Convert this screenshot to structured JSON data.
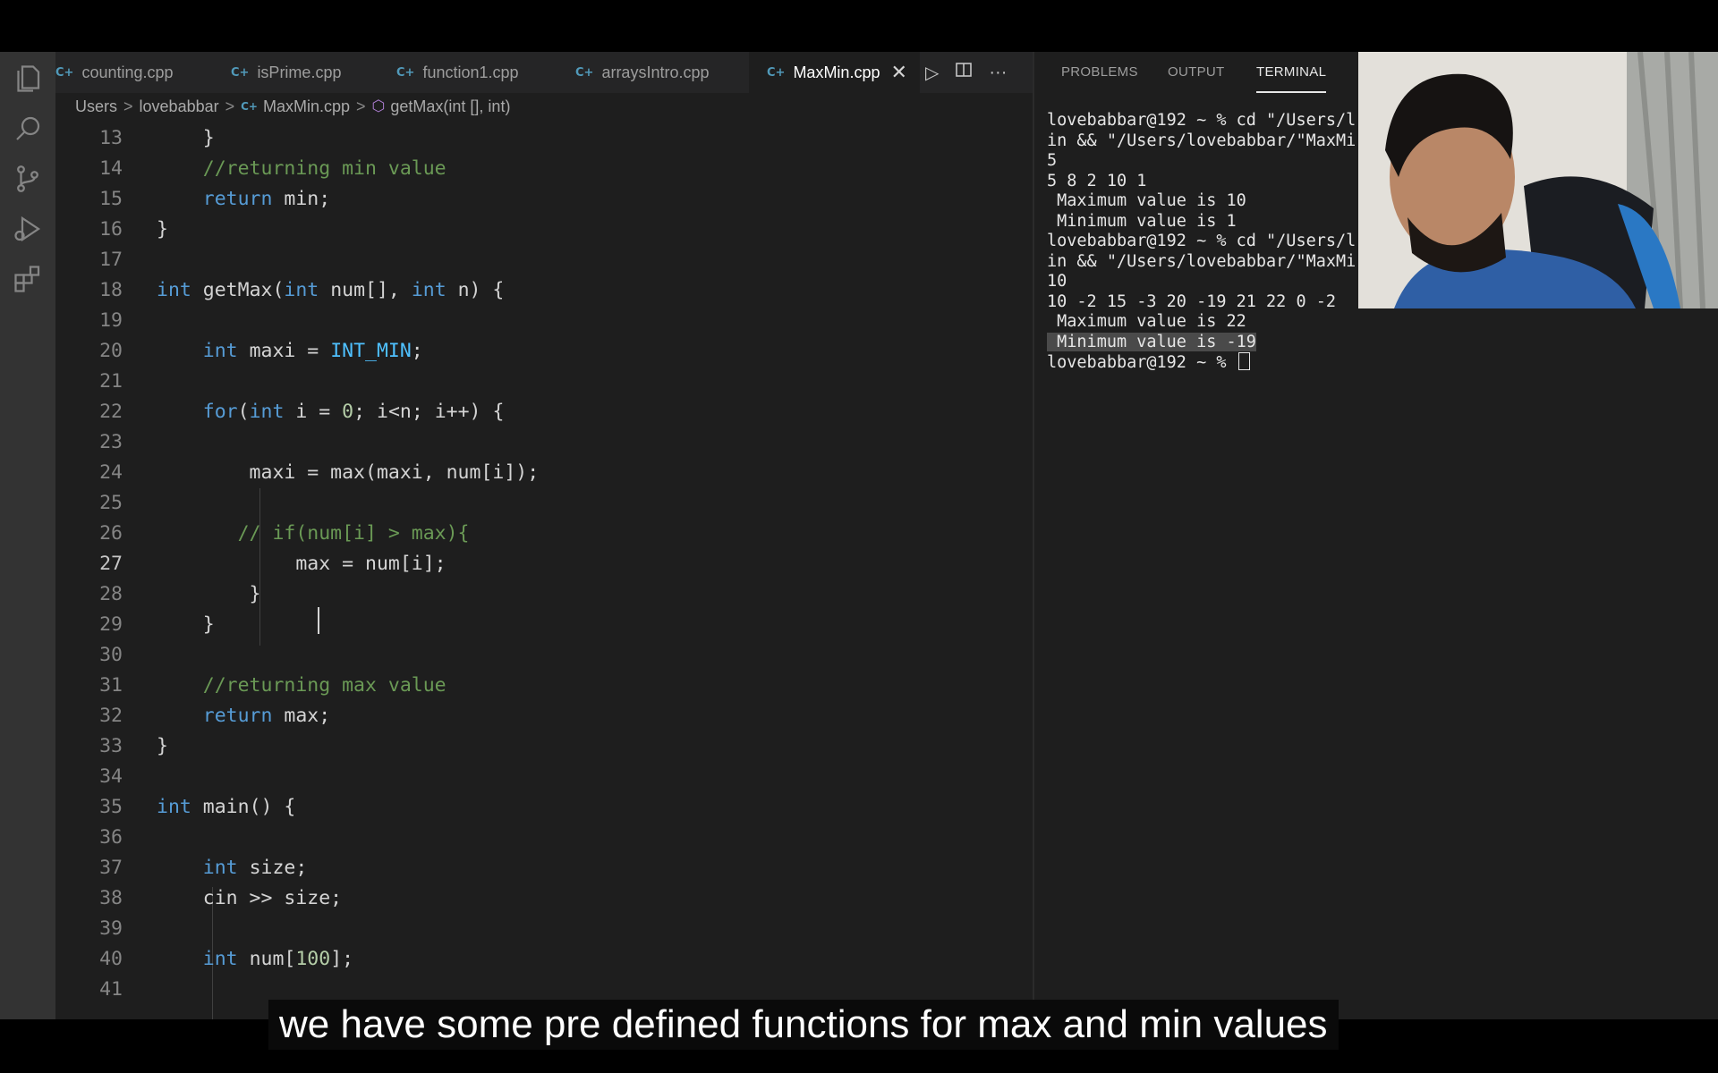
{
  "tabs": [
    {
      "label": "counting.cpp",
      "icon": "C++ file icon",
      "active": false
    },
    {
      "label": "isPrime.cpp",
      "icon": "C++ file icon",
      "active": false
    },
    {
      "label": "function1.cpp",
      "icon": "C++ file icon",
      "active": false
    },
    {
      "label": "arraysIntro.cpp",
      "icon": "C++ file icon",
      "active": false
    },
    {
      "label": "MaxMin.cpp",
      "icon": "C++ file icon",
      "active": true
    }
  ],
  "tab_icon_text": "C+",
  "close_glyph": "✕",
  "editor_actions": {
    "run": "▷",
    "split": "split-editor-icon",
    "more": "···"
  },
  "breadcrumb": {
    "segments": [
      "Users",
      "lovebabbar",
      "MaxMin.cpp",
      "getMax(int [], int)"
    ],
    "separator": ">"
  },
  "editor": {
    "current_line": 27,
    "lines": [
      {
        "n": "13",
        "code": "    }"
      },
      {
        "n": "14",
        "code": "    //returning min value"
      },
      {
        "n": "15",
        "code": "    return min;"
      },
      {
        "n": "16",
        "code": "}"
      },
      {
        "n": "17",
        "code": ""
      },
      {
        "n": "18",
        "code": "int getMax(int num[], int n) {"
      },
      {
        "n": "19",
        "code": ""
      },
      {
        "n": "20",
        "code": "    int maxi = INT_MIN;"
      },
      {
        "n": "21",
        "code": ""
      },
      {
        "n": "22",
        "code": "    for(int i = 0; i<n; i++) {"
      },
      {
        "n": "23",
        "code": ""
      },
      {
        "n": "24",
        "code": "        maxi = max(maxi, num[i]);"
      },
      {
        "n": "25",
        "code": ""
      },
      {
        "n": "26",
        "code": "       // if(num[i] > max){"
      },
      {
        "n": "27",
        "code": "            max = num[i];"
      },
      {
        "n": "28",
        "code": "        }"
      },
      {
        "n": "29",
        "code": "    }"
      },
      {
        "n": "30",
        "code": ""
      },
      {
        "n": "31",
        "code": "    //returning max value"
      },
      {
        "n": "32",
        "code": "    return max;"
      },
      {
        "n": "33",
        "code": "}"
      },
      {
        "n": "34",
        "code": ""
      },
      {
        "n": "35",
        "code": "int main() {"
      },
      {
        "n": "36",
        "code": ""
      },
      {
        "n": "37",
        "code": "    int size;"
      },
      {
        "n": "38",
        "code": "    cin >> size;"
      },
      {
        "n": "39",
        "code": ""
      },
      {
        "n": "40",
        "code": "    int num[100];"
      },
      {
        "n": "41",
        "code": ""
      }
    ]
  },
  "panel": {
    "tabs": [
      "PROBLEMS",
      "OUTPUT",
      "TERMINAL"
    ],
    "active_tab": "TERMINAL",
    "terminal_lines": [
      "lovebabbar@192 ~ % cd \"/Users/l",
      "in && \"/Users/lovebabbar/\"MaxMi",
      "5",
      "5 8 2 10 1",
      " Maximum value is 10",
      " Minimum value is 1",
      "lovebabbar@192 ~ % cd \"/Users/l",
      "in && \"/Users/lovebabbar/\"MaxMi",
      "10",
      "10 -2 15 -3 20 -19 21 22 0 -2",
      " Maximum value is 22",
      " Minimum value is -19",
      "lovebabbar@192 ~ % "
    ],
    "selected_line_index": 11
  },
  "caption": "we have some pre defined functions  for max and min values",
  "colors": {
    "editor_bg": "#1e1e1e",
    "activity_bar": "#333333",
    "keyword": "#569cd6",
    "comment": "#6a9955",
    "constant": "#4fc1ff",
    "number": "#b5cea8"
  }
}
